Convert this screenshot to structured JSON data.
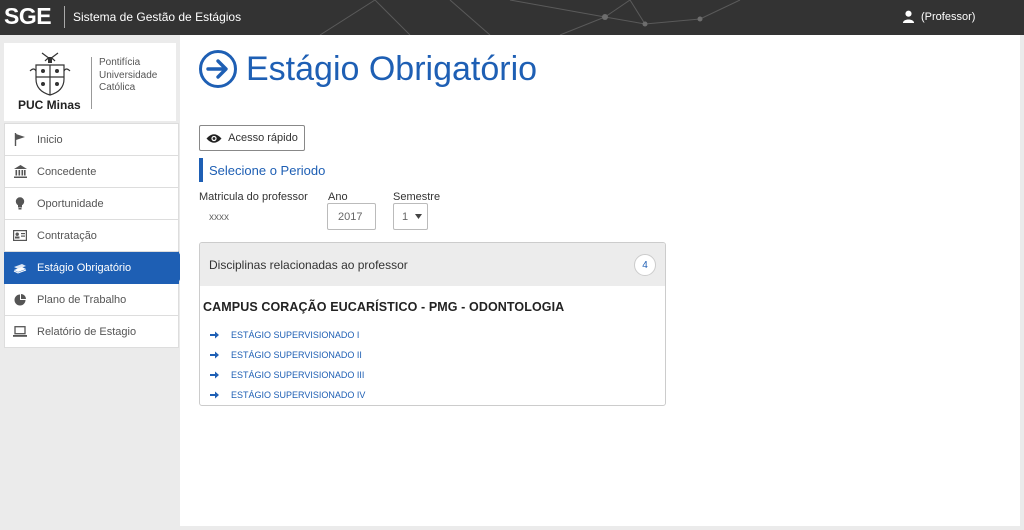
{
  "app": {
    "brand": "SGE",
    "system_title": "Sistema de Gestão de Estágios",
    "user_label": "(Professor)"
  },
  "logo": {
    "name": "PUC Minas",
    "lines": [
      "Pontifícia",
      "Universidade",
      "Católica"
    ]
  },
  "sidebar": {
    "items": [
      {
        "label": "Inicio",
        "icon": "flag-icon"
      },
      {
        "label": "Concedente",
        "icon": "bank-icon"
      },
      {
        "label": "Oportunidade",
        "icon": "lightbulb-icon"
      },
      {
        "label": "Contratação",
        "icon": "id-card-icon"
      },
      {
        "label": "Estágio Obrigatório",
        "icon": "books-icon",
        "active": true
      },
      {
        "label": "Plano de Trabalho",
        "icon": "pie-chart-icon"
      },
      {
        "label": "Relatório de Estagio",
        "icon": "laptop-icon"
      }
    ]
  },
  "main": {
    "title": "Estágio Obrigatório",
    "quick_access_label": "Acesso rápido",
    "section_title": "Selecione o Periodo",
    "form": {
      "matricula_label": "Matricula do professor",
      "matricula_value": "xxxx",
      "ano_label": "Ano",
      "ano_value": "2017",
      "semestre_label": "Semestre",
      "semestre_value": "1"
    },
    "panel": {
      "title": "Disciplinas relacionadas ao professor",
      "count": "4",
      "campus": "CAMPUS CORAÇÃO EUCARÍSTICO - PMG - ODONTOLOGIA",
      "disciplines": [
        "ESTÁGIO SUPERVISIONADO I",
        "ESTÁGIO SUPERVISIONADO II",
        "ESTÁGIO SUPERVISIONADO III",
        "ESTÁGIO SUPERVISIONADO IV"
      ]
    }
  },
  "colors": {
    "accent": "#1e5fb4",
    "topbar": "#333333",
    "background": "#ebebeb"
  }
}
